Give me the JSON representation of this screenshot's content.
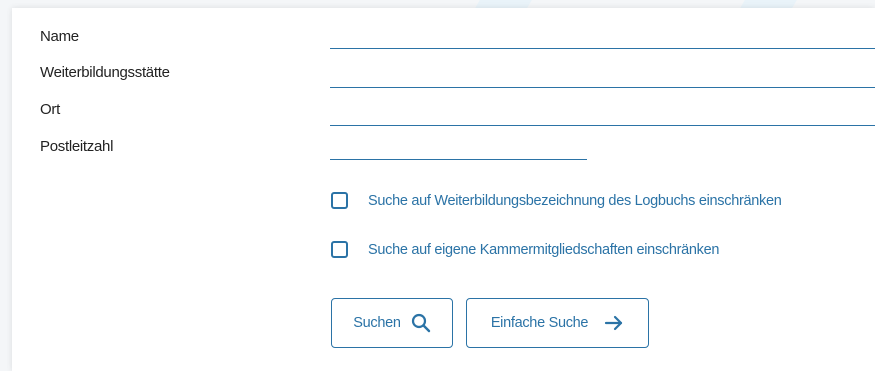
{
  "form": {
    "fields": [
      {
        "label": "Name",
        "value": ""
      },
      {
        "label": "Weiterbildungsstätte",
        "value": ""
      },
      {
        "label": "Ort",
        "value": ""
      },
      {
        "label": "Postleitzahl",
        "value": ""
      }
    ],
    "checkboxes": [
      {
        "label": "Suche auf Weiterbildungsbezeichnung des Logbuchs einschränken",
        "checked": false
      },
      {
        "label": "Suche auf eigene Kammermitgliedschaften einschränken",
        "checked": false
      }
    ],
    "buttons": {
      "search_label": "Suchen",
      "search_icon": "search-icon",
      "simple_label": "Einfache Suche",
      "simple_icon": "arrow-right-icon"
    }
  },
  "colors": {
    "accent": "#2b73a6",
    "label_text": "#222222",
    "background": "#f4f6f8",
    "card": "#ffffff"
  }
}
